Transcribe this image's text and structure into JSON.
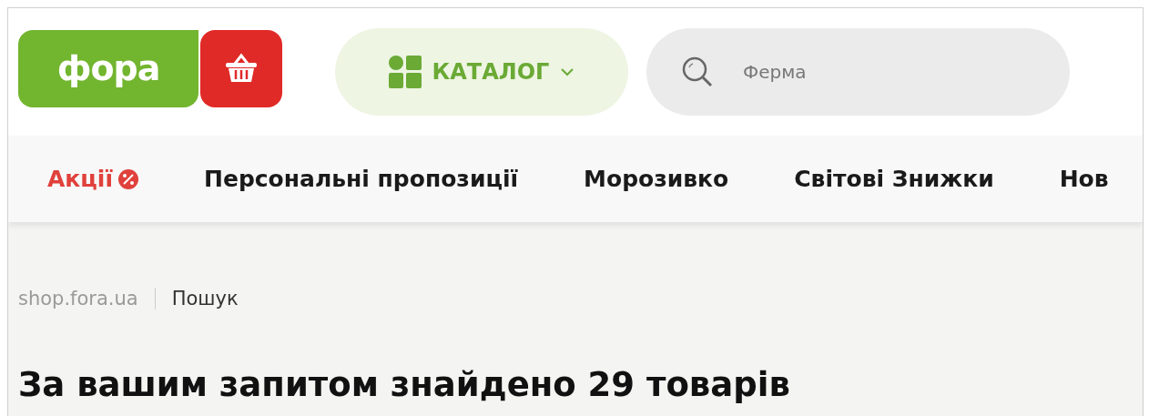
{
  "logo": {
    "text": "фора"
  },
  "catalog_button": {
    "label": "КАТАЛОГ"
  },
  "search": {
    "value": "Ферма"
  },
  "nav": [
    {
      "label": "Акції",
      "kind": "promo"
    },
    {
      "label": "Персональні пропозиції",
      "kind": "plain"
    },
    {
      "label": "Морозивко",
      "kind": "plain"
    },
    {
      "label": "Світові Знижки",
      "kind": "plain"
    },
    {
      "label": "Нов",
      "kind": "plain"
    }
  ],
  "breadcrumbs": [
    "shop.fora.ua",
    "Пошук"
  ],
  "heading": "За вашим запитом знайдено 29 товарів"
}
